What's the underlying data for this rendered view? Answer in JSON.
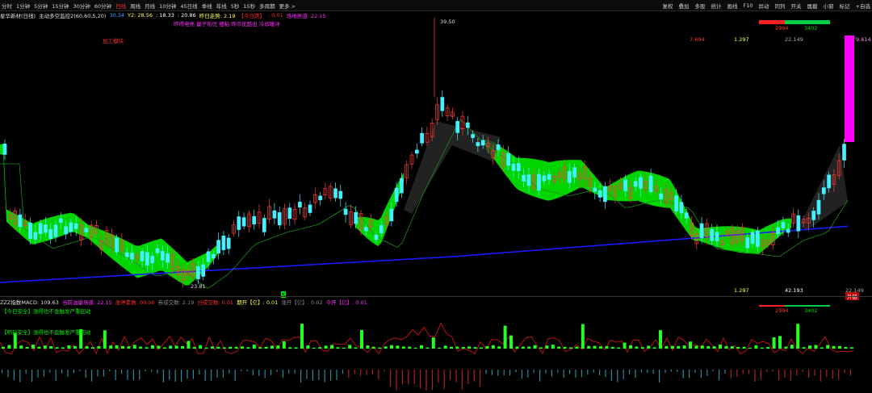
{
  "toolbar": {
    "periods": [
      "分时",
      "1分钟",
      "5分钟",
      "15分钟",
      "30分钟",
      "60分钟",
      "日线",
      "周线",
      "月线",
      "10分钟",
      "45日线",
      "季线",
      "年线",
      "5秒",
      "15秒",
      "多周期",
      "更多 >"
    ],
    "active_period": "日线",
    "tools": [
      "复权",
      "叠加",
      "多股",
      "统计",
      "画线",
      "F10",
      "异动",
      "同列",
      "开关",
      "属截",
      "小窗",
      "标记",
      "+自选"
    ]
  },
  "info": {
    "stock": "星华新材(日线)",
    "indicator": "主动多空监控2(60,60,5,20)",
    "v1": "30.34",
    "v2": "Y2: 28.56",
    "v3": ": 18.33",
    "v4": ": 20.86",
    "v5": "昨日走势: 2.19",
    "v6": "【今日跌】",
    "v7": ": 0.01",
    "v8": "场地亮道: 22.15",
    "line2": "昨得电亮 量子布优 细粘 昨市优酷出 冷却暖冲"
  },
  "labels": {
    "red_note": "加工模块",
    "high_price": "39.50",
    "low_price": "23.81",
    "top_r1": "7.694",
    "top_r2": "1.297",
    "top_r3": "22.149",
    "bot_r1": "1.297",
    "bot_r2": "42.193",
    "bot_r3": "22.149",
    "mini1": "2994",
    "mini2": "3402",
    "magenta_val": "9.614",
    "corner_badge": "外链",
    "mini3": "2994",
    "mini4": "3402",
    "small_char": "K"
  },
  "macd": {
    "title": "ZZZ指数MACD: 109.63",
    "a": "当前油量场道: 22.15",
    "b": "涨停素数: 00.00",
    "c": "",
    "d": "券成交数: 2.19",
    "e": "分成交数: 0.01",
    "f": "期开【亿】: 0.01",
    "g": "涨开【亿】: 0.02",
    "h": "今开【亿】: 0.01",
    "line1": "【今日安全】涨得也不会触发严重回动",
    "line2": "【明日安全】涨得也不会触发严重回动"
  },
  "colors": {
    "up": "#ff3b3b",
    "down": "#44f0ff",
    "band": "#00e000",
    "ma": "#1a1aff",
    "magenta": "#ff00ff"
  }
}
